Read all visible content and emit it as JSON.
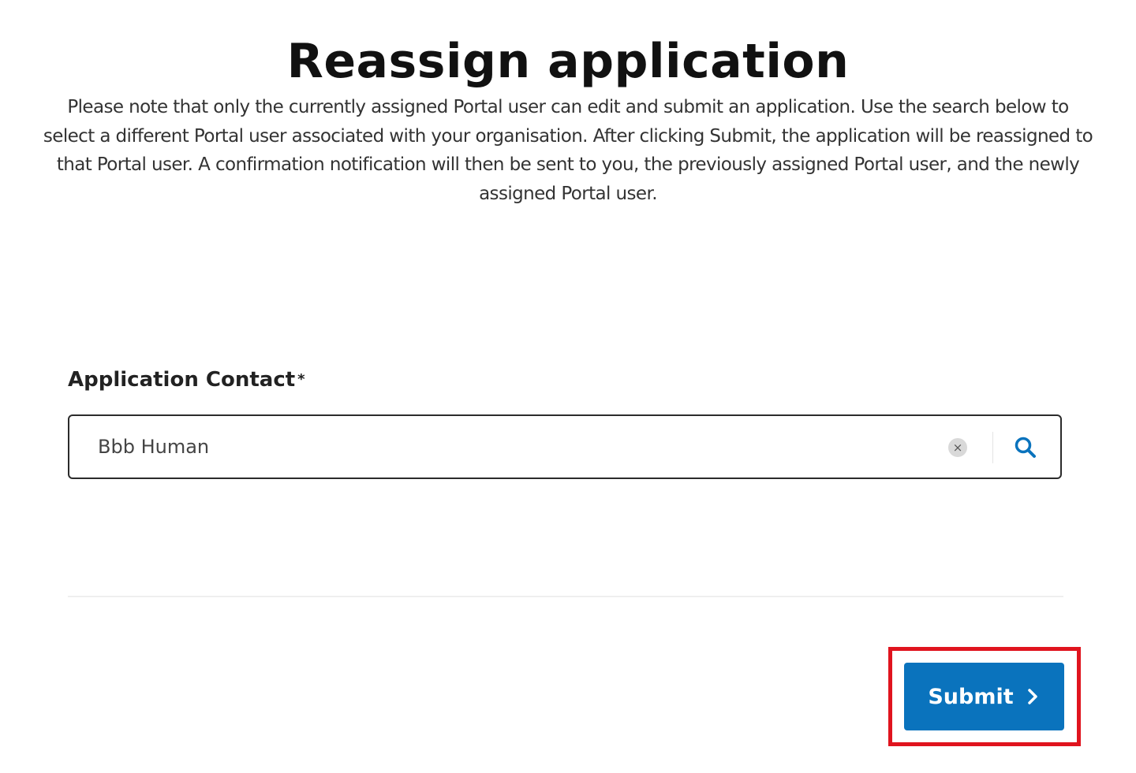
{
  "page": {
    "title": "Reassign application",
    "description": "Please note that only the currently assigned Portal user can edit and submit an application. Use the search below to select a different Portal user associated with your organisation. After clicking Submit, the application will be reassigned to that Portal user. A confirmation notification will then be sent to you, the previously assigned Portal user, and the newly assigned Portal user."
  },
  "form": {
    "contact_label": "Application Contact",
    "required_marker": "*",
    "contact_value": "Bbb Human",
    "clear_glyph": "×",
    "clear_icon": "clear-icon",
    "search_icon": "search-icon"
  },
  "actions": {
    "submit_label": "Submit",
    "submit_icon": "chevron-right-icon",
    "highlight_color": "#e0141e"
  },
  "colors": {
    "primary": "#0a73bd",
    "text": "#1f1f1f",
    "border": "#2b2b2b"
  }
}
